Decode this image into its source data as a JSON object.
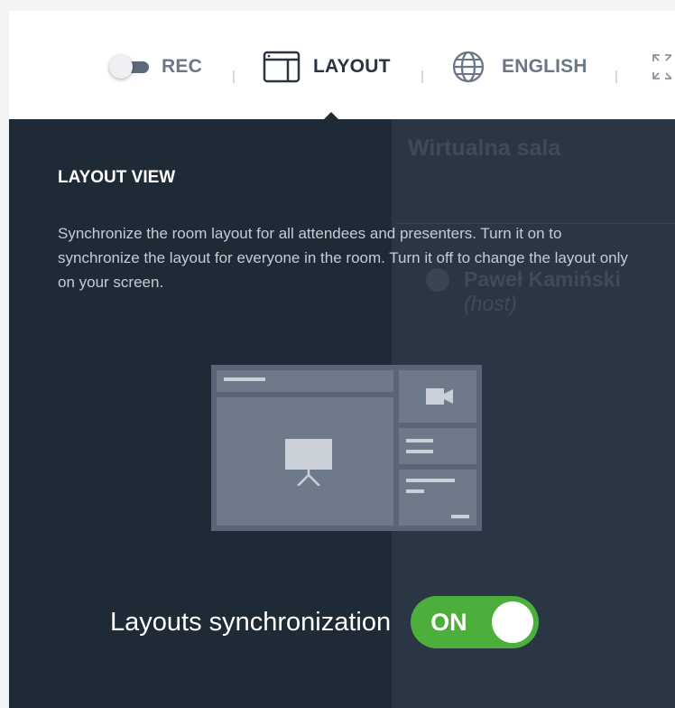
{
  "toolbar": {
    "rec_label": "REC",
    "layout_label": "LAYOUT",
    "language_label": "ENGLISH"
  },
  "background": {
    "room_name": "Wirtualna sala",
    "participant_name": "Paweł Kamiński",
    "participant_note": "(host)"
  },
  "panel": {
    "title": "LAYOUT VIEW",
    "description": "Synchronize the room layout for all attendees and presenters. Turn it on to synchronize the layout for everyone in the room. Turn it off to change the layout only on your screen.",
    "sync_label": "Layouts synchronization",
    "sync_state": "ON"
  },
  "colors": {
    "panel_bg": "#1f2a37",
    "toggle_on": "#4caf3c",
    "illustration": "#5a6677"
  },
  "icons": [
    "rec-toggle-icon",
    "layout-icon",
    "globe-icon",
    "fullscreen-icon",
    "video-camera-icon",
    "presentation-screen-icon"
  ]
}
